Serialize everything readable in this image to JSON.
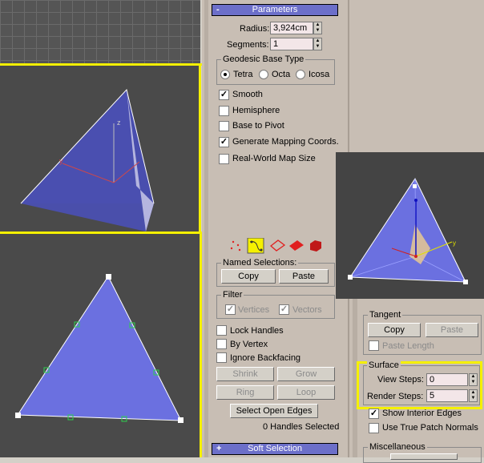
{
  "parameters": {
    "title": "Parameters",
    "collapse_symbol": "-",
    "radius_label": "Radius:",
    "radius_value": "3,924cm",
    "segments_label": "Segments:",
    "segments_value": "1",
    "geodesic_title": "Geodesic Base Type",
    "tetra": "Tetra",
    "octa": "Octa",
    "icosa": "Icosa",
    "smooth": "Smooth",
    "hemisphere": "Hemisphere",
    "base_to_pivot": "Base to Pivot",
    "gen_mapping": "Generate Mapping Coords.",
    "realworld": "Real-World Map Size"
  },
  "selection": {
    "named_title": "Named Selections:",
    "copy": "Copy",
    "paste": "Paste",
    "filter_title": "Filter",
    "vertices": "Vertices",
    "vectors": "Vectors",
    "lock_handles": "Lock Handles",
    "by_vertex": "By Vertex",
    "ignore_backfacing": "Ignore Backfacing",
    "shrink": "Shrink",
    "grow": "Grow",
    "ring": "Ring",
    "loop": "Loop",
    "select_open_edges": "Select Open Edges",
    "handles_selected": "0 Handles Selected"
  },
  "soft_selection": {
    "title": "Soft Selection",
    "expand_symbol": "+"
  },
  "right_panel": {
    "tangent_title": "Tangent",
    "copy": "Copy",
    "paste": "Paste",
    "paste_length": "Paste Length",
    "surface_title": "Surface",
    "view_steps_label": "View Steps:",
    "view_steps_value": "0",
    "render_steps_label": "Render Steps:",
    "render_steps_value": "5",
    "show_interior": "Show Interior Edges",
    "true_patch": "Use True Patch Normals",
    "misc_title": "Miscellaneous"
  },
  "viewport": {
    "axis_z": "z",
    "axis_y": "y",
    "axis_x": "x"
  },
  "colors": {
    "highlight": "#f5f000",
    "rollout": "#6c6fc9",
    "mesh": "#6b70e0",
    "viewport_bg": "#4a4a4a"
  },
  "icons": [
    "vertex-icon",
    "handle-icon",
    "edge-icon",
    "face-icon",
    "element-icon"
  ]
}
